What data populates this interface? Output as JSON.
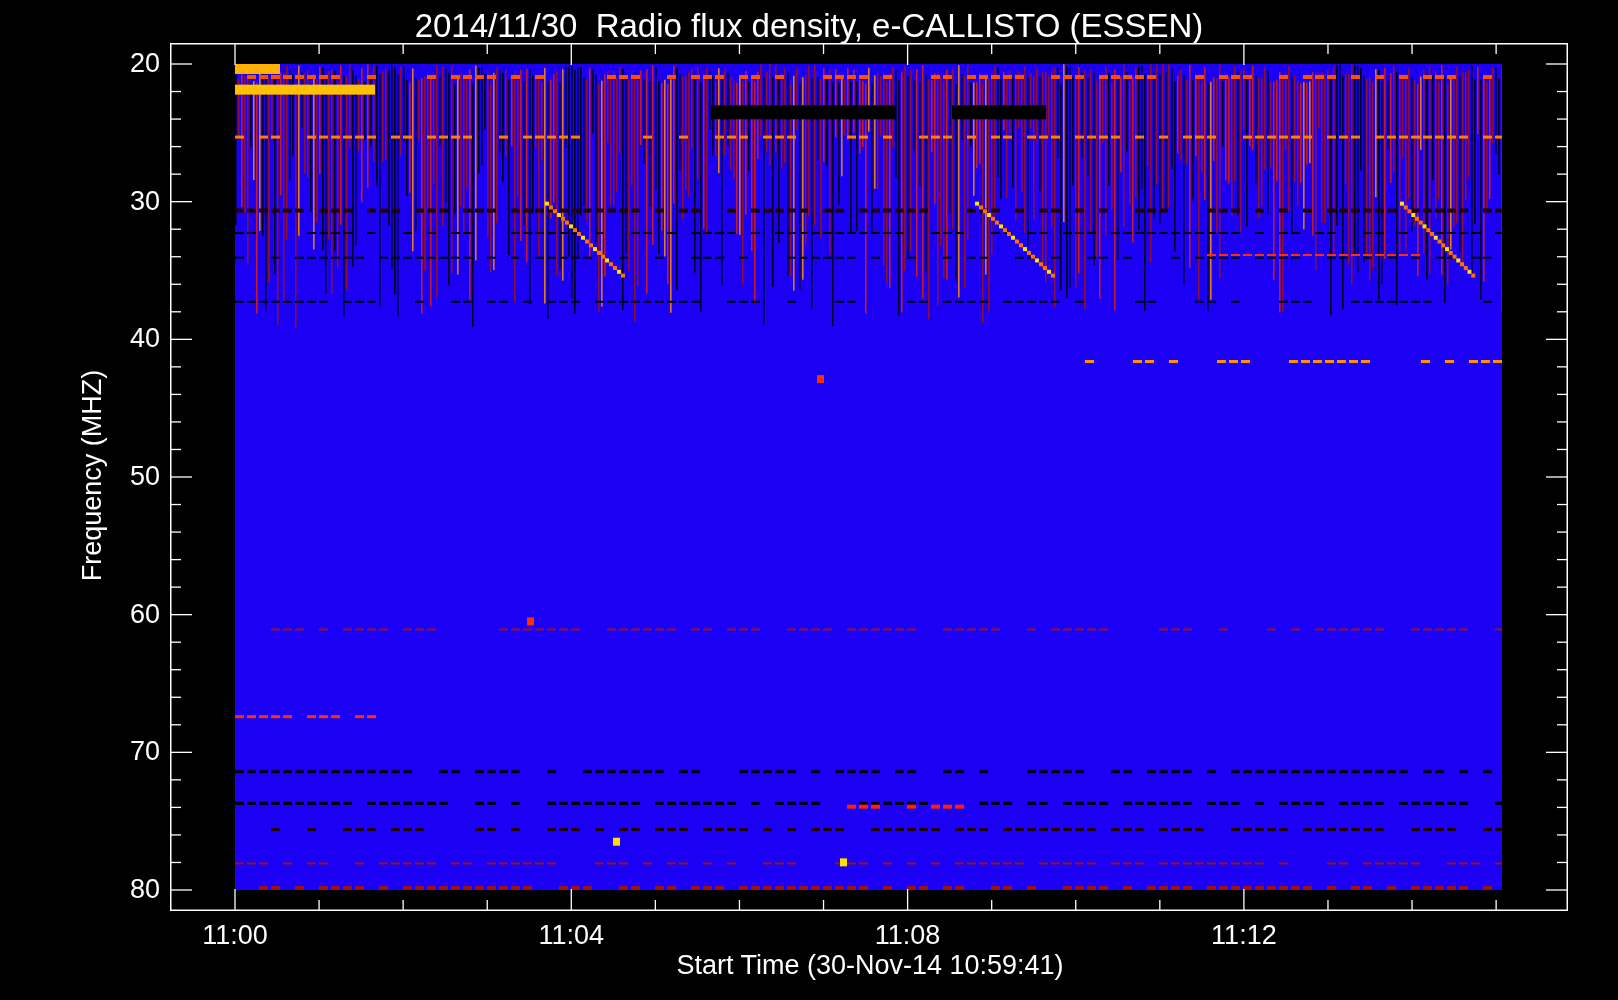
{
  "title": "2014/11/30  Radio flux density, e-CALLISTO (ESSEN)",
  "y_axis": {
    "label": "Frequency (MHZ)",
    "ticks": [
      "20",
      "30",
      "40",
      "50",
      "60",
      "70",
      "80"
    ]
  },
  "x_axis": {
    "label": "Start Time (30-Nov-14 10:59:41)",
    "ticks": [
      "11:00",
      "11:04",
      "11:08",
      "11:12"
    ]
  }
}
